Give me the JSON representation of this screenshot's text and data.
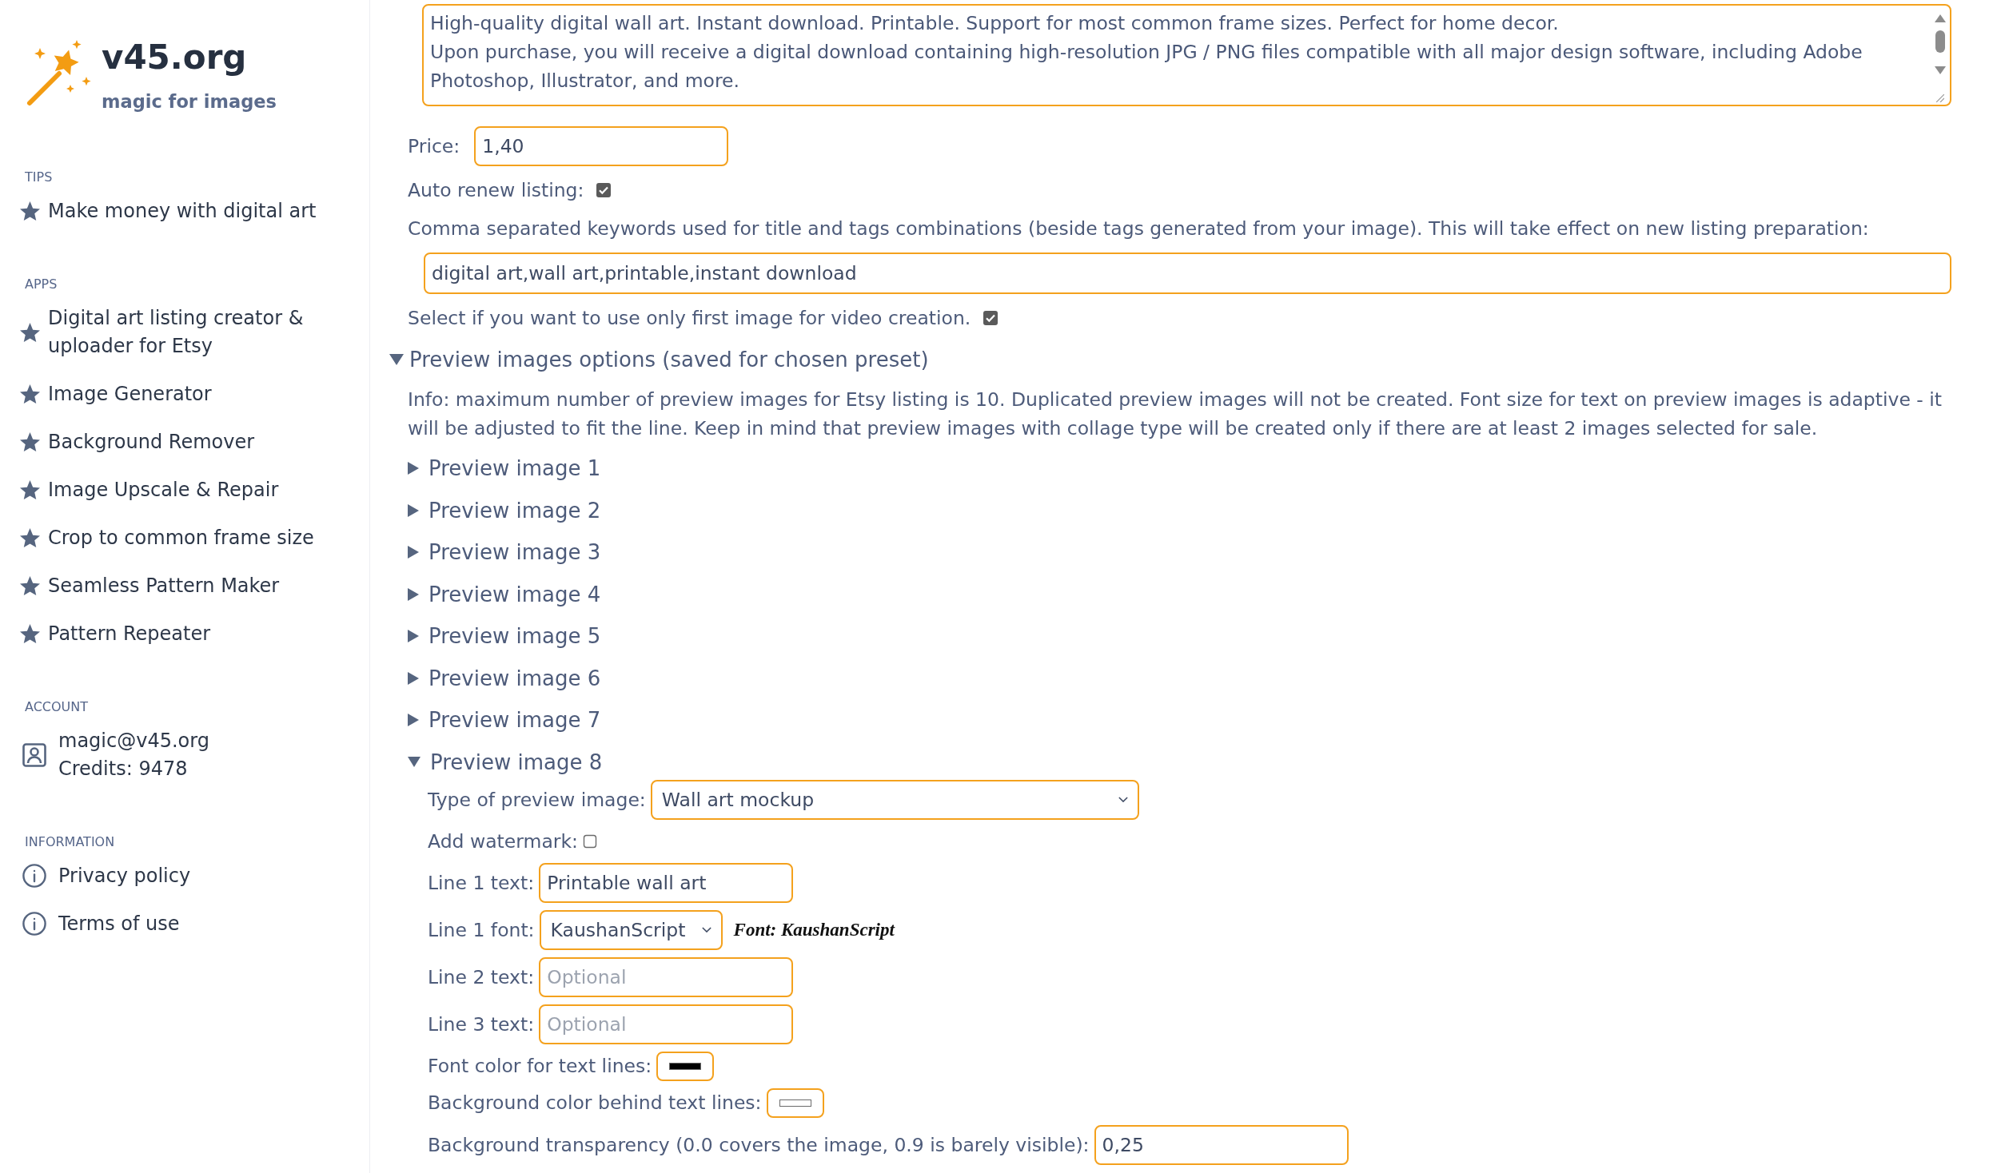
{
  "sidebar": {
    "logo": {
      "title": "v45.org",
      "tagline": "magic for images"
    },
    "sections": [
      {
        "heading": "TIPS",
        "items": [
          {
            "kind": "star",
            "label": "Make money with digital art"
          }
        ]
      },
      {
        "heading": "APPS",
        "items": [
          {
            "kind": "star",
            "label": "Digital art listing creator & uploader for Etsy"
          },
          {
            "kind": "star",
            "label": "Image Generator"
          },
          {
            "kind": "star",
            "label": "Background Remover"
          },
          {
            "kind": "star",
            "label": "Image Upscale & Repair"
          },
          {
            "kind": "star",
            "label": "Crop to common frame size"
          },
          {
            "kind": "star",
            "label": "Seamless Pattern Maker"
          },
          {
            "kind": "star",
            "label": "Pattern Repeater"
          }
        ]
      },
      {
        "heading": "ACCOUNT",
        "items": [
          {
            "kind": "account",
            "label": "magic@v45.org",
            "detail": "Credits: 9478"
          }
        ]
      },
      {
        "heading": "INFORMATION",
        "items": [
          {
            "kind": "info",
            "label": "Privacy policy"
          },
          {
            "kind": "info",
            "label": "Terms of use"
          }
        ]
      }
    ]
  },
  "form": {
    "description": {
      "value": "High-quality digital wall art. Instant download. Printable. Support for most common frame sizes. Perfect for home decor.\nUpon purchase, you will receive a digital download containing high-resolution JPG / PNG files compatible with all major design software, including Adobe Photoshop, Illustrator, and more."
    },
    "fields": [
      {
        "kind": "text",
        "label": "Price:",
        "value": "1,40"
      },
      {
        "kind": "checkbox",
        "label": "Auto renew listing:",
        "checked": true
      },
      {
        "kind": "wide_text",
        "label": "Comma separated keywords used for title and tags combinations (beside tags generated from your image). This will take effect on new listing preparation:",
        "value": "digital art,wall art,printable,instant download"
      },
      {
        "kind": "checkbox",
        "label": "Select if you want to use only first image for video creation.",
        "checked": true
      }
    ],
    "preview_options": {
      "title": "Preview images options (saved for chosen preset)",
      "expanded": true,
      "info": "Info: maximum number of preview images for Etsy listing is 10. Duplicated preview images will not be created. Font size for text on preview images is adaptive - it will be adjusted to fit the line. Keep in mind that preview images with collage type will be created only if there are at least 2 images selected for sale.",
      "images": [
        {
          "title": "Preview image 1",
          "expanded": false
        },
        {
          "title": "Preview image 2",
          "expanded": false
        },
        {
          "title": "Preview image 3",
          "expanded": false
        },
        {
          "title": "Preview image 4",
          "expanded": false
        },
        {
          "title": "Preview image 5",
          "expanded": false
        },
        {
          "title": "Preview image 6",
          "expanded": false
        },
        {
          "title": "Preview image 7",
          "expanded": false
        },
        {
          "title": "Preview image 8",
          "expanded": true,
          "fields": [
            {
              "kind": "select",
              "label": "Type of preview image:",
              "value": "Wall art mockup"
            },
            {
              "kind": "checkbox",
              "label": "Add watermark:",
              "checked": false
            },
            {
              "kind": "text",
              "label": "Line 1 text:",
              "value": "Printable wall art"
            },
            {
              "kind": "font_select",
              "label": "Line 1 font:",
              "value": "KaushanScript",
              "sample": "Font: KaushanScript"
            },
            {
              "kind": "text",
              "label": "Line 2 text:",
              "placeholder": "Optional"
            },
            {
              "kind": "text",
              "label": "Line 3 text:",
              "placeholder": "Optional"
            },
            {
              "kind": "color",
              "label": "Font color for text lines:",
              "color": "#000000"
            },
            {
              "kind": "color",
              "label": "Background color behind text lines:",
              "color": "#ffffff"
            },
            {
              "kind": "text",
              "label": "Background transparency (0.0 covers the image, 0.9 is barely visible):",
              "value": "0,25"
            }
          ]
        }
      ]
    }
  }
}
